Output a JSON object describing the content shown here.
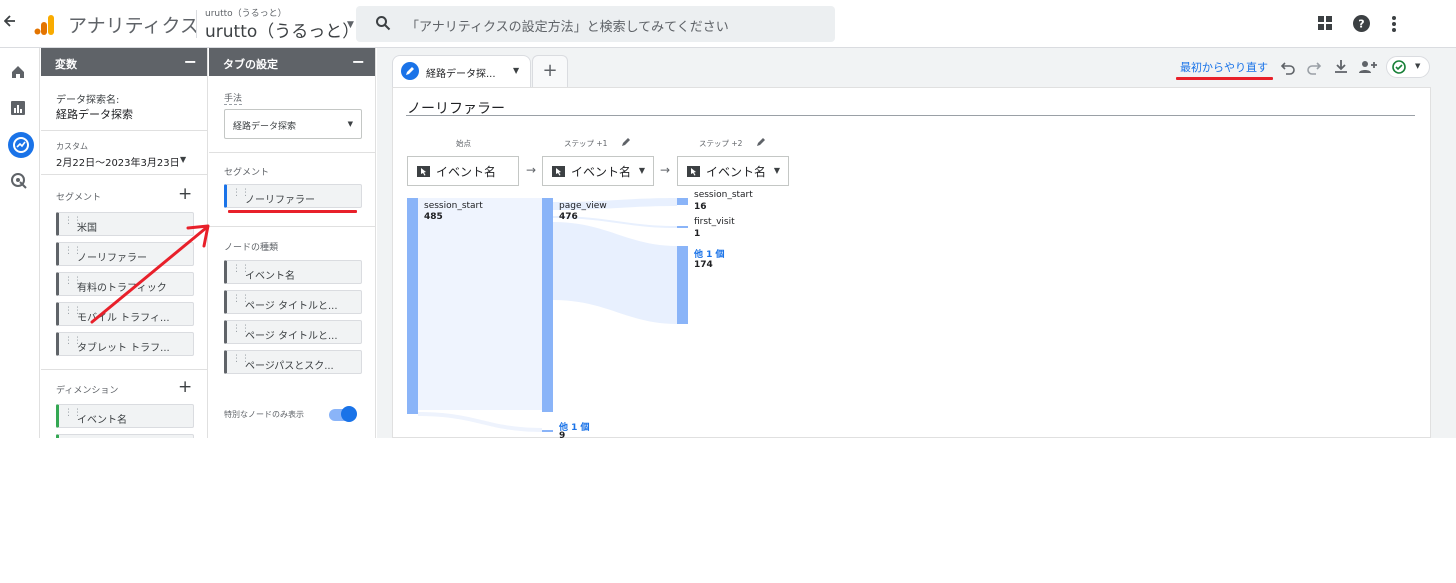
{
  "topbar": {
    "app_title": "アナリティクス",
    "account_small": "urutto（うるっと）",
    "account_name": "urutto（うるっと）",
    "search_placeholder": "「アナリティクスの設定方法」と検索してみてください"
  },
  "variables_panel": {
    "header": "変数",
    "exploration_name_label": "データ探索名:",
    "exploration_name": "経路データ探索",
    "date_label": "カスタム",
    "date_range": "2月22日～2023年3月23日",
    "segments_label": "セグメント",
    "segments": [
      "米国",
      "ノーリファラー",
      "有料のトラフィック",
      "モバイル トラフィ...",
      "タブレット トラフ..."
    ],
    "dimensions_label": "ディメンション",
    "dimensions": [
      "イベント名"
    ]
  },
  "tab_settings_panel": {
    "header": "タブの設定",
    "technique_label": "手法",
    "technique_value": "経路データ探索",
    "segment_label": "セグメント",
    "segment_value": "ノーリファラー",
    "node_type_label": "ノードの種類",
    "node_types": [
      "イベント名",
      "ページ タイトルと...",
      "ページ タイトルと...",
      "ページパスとスク..."
    ],
    "unique_nodes_label": "特別なノードのみ表示"
  },
  "canvas": {
    "tab_label": "経路データ探...",
    "restart_label": "最初からやり直す",
    "title": "ノーリファラー",
    "steps": [
      {
        "label": "始点",
        "selector": "イベント名"
      },
      {
        "label": "ステップ +1",
        "selector": "イベント名"
      },
      {
        "label": "ステップ +2",
        "selector": "イベント名"
      }
    ],
    "nodes": {
      "start": {
        "name": "session_start",
        "value": "485"
      },
      "step1": {
        "name": "page_view",
        "value": "476",
        "other_label": "他 1 個",
        "other_value": "9"
      },
      "step2": [
        {
          "name": "session_start",
          "value": "16"
        },
        {
          "name": "first_visit",
          "value": "1"
        },
        {
          "name": "他 1 個",
          "value": "174"
        }
      ]
    }
  },
  "colors": {
    "accent": "#1a73e8",
    "flow_bar": "#8ab4f8",
    "annotation": "#e8202a"
  }
}
